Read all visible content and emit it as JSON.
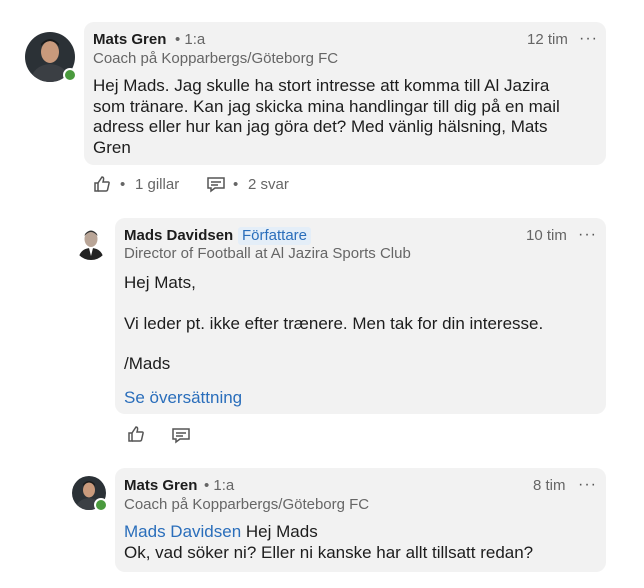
{
  "comments": [
    {
      "author": "Mats Gren",
      "degree": "• 1:a",
      "subtitle": "Coach på Kopparbergs/Göteborg FC",
      "time": "12 tim",
      "more": "···",
      "text_lines": [
        "Hej Mads. Jag skulle ha stort intresse att komma till Al Jazira",
        "som tränare. Kan jag skicka mina handlingar till dig på en mail",
        "adress eller hur kan jag göra det? Med vänlig hälsning, Mats",
        "Gren"
      ],
      "like_count": "1 gillar",
      "reply_count": "2 svar",
      "separator": "•"
    },
    {
      "author": "Mads Davidsen",
      "badge": "Författare",
      "subtitle": "Director of Football at Al Jazira Sports Club",
      "time": "10 tim",
      "more": "···",
      "greeting": "Hej Mats,",
      "body": "Vi leder pt. ikke efter trænere. Men tak for din interesse.",
      "signoff": "/Mads",
      "translate_link": "Se översättning"
    },
    {
      "author": "Mats Gren",
      "degree": "• 1:a",
      "subtitle": "Coach på Kopparbergs/Göteborg FC",
      "time": "8 tim",
      "more": "···",
      "mention": "Mads Davidsen",
      "line1_rest": " Hej Mads",
      "line2": "Ok, vad söker ni? Eller ni kanske har allt tillsatt redan?"
    }
  ],
  "colors": {
    "bubble": "#f2f2f2",
    "link": "#2a6ebb",
    "online": "#4a9a3d",
    "muted": "#666666"
  },
  "icons": [
    "like-icon",
    "comment-icon",
    "more-icon",
    "online-status-icon"
  ]
}
